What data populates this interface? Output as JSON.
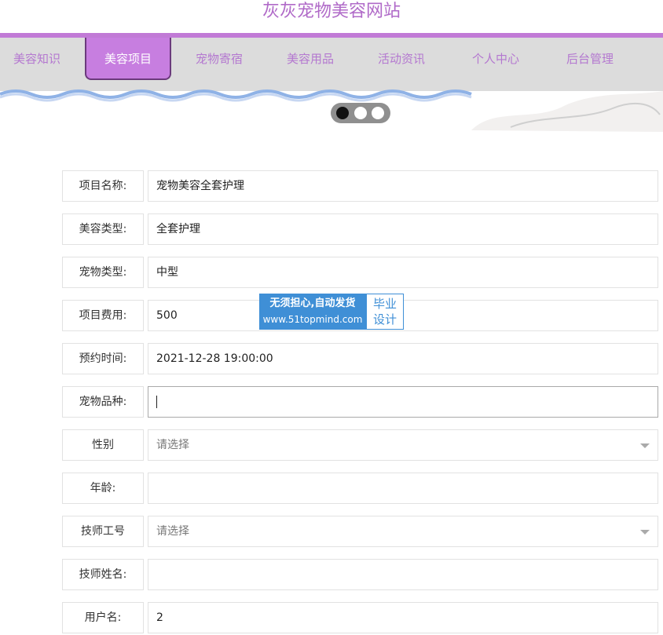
{
  "site": {
    "title": "灰灰宠物美容网站"
  },
  "nav": {
    "items": [
      "美容知识",
      "美容项目",
      "宠物寄宿",
      "美容用品",
      "活动资讯",
      "个人中心",
      "后台管理"
    ],
    "active_index": 1
  },
  "carousel": {
    "slide_count": 3,
    "active_slide": 0
  },
  "form": {
    "rows": [
      {
        "label": "项目名称:",
        "value": "宠物美容全套护理",
        "type": "text"
      },
      {
        "label": "美容类型:",
        "value": "全套护理",
        "type": "text"
      },
      {
        "label": "宠物类型:",
        "value": "中型",
        "type": "text"
      },
      {
        "label": "项目费用:",
        "value": "500",
        "type": "text"
      },
      {
        "label": "预约时间:",
        "value": "2021-12-28 19:00:00",
        "type": "text"
      },
      {
        "label": "宠物品种:",
        "value": "",
        "type": "text",
        "focused": true
      },
      {
        "label": "性别",
        "value": "请选择",
        "type": "select"
      },
      {
        "label": "年龄:",
        "value": "",
        "type": "text"
      },
      {
        "label": "技师工号",
        "value": "请选择",
        "type": "select"
      },
      {
        "label": "技师姓名:",
        "value": "",
        "type": "text"
      },
      {
        "label": "用户名:",
        "value": "2",
        "type": "text"
      }
    ]
  },
  "watermark": {
    "line1": "无须担心,自动发货",
    "line2": "www.51topmind.com",
    "badge_top": "毕业",
    "badge_bottom": "设计"
  },
  "colors": {
    "accent": "#c77ee0",
    "title": "#b06ac8",
    "nav_bg": "#dcdcdc",
    "watermark_blue": "#3f8fd6"
  }
}
